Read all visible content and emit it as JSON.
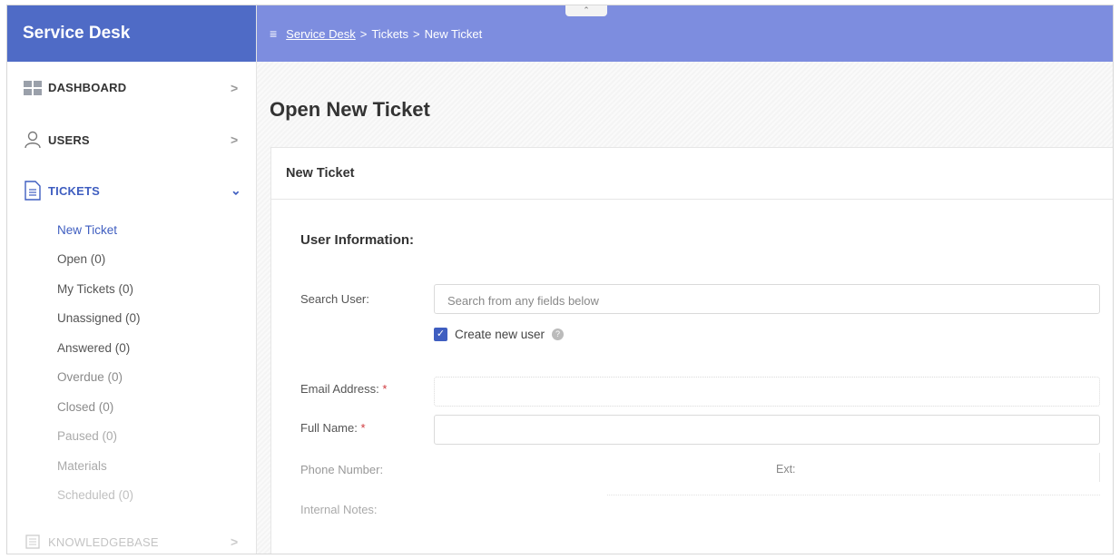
{
  "sidebar": {
    "brand": "Service Desk",
    "items": [
      {
        "label": "DASHBOARD",
        "icon": "dashboard-icon",
        "chevron": ">"
      },
      {
        "label": "USERS",
        "icon": "user-icon",
        "chevron": ">"
      },
      {
        "label": "TICKETS",
        "icon": "ticket-icon",
        "chevron": "⌄"
      },
      {
        "label": "KNOWLEDGEBASE",
        "icon": "knowledgebase-icon",
        "chevron": ">"
      }
    ],
    "ticket_sub_items": [
      "New Ticket",
      "Open (0)",
      "My Tickets (0)",
      "Unassigned (0)",
      "Answered (0)",
      "Overdue (0)",
      "Closed (0)",
      "Paused (0)",
      "Materials",
      "Scheduled (0)"
    ]
  },
  "topbar": {
    "menu_icon": "≡",
    "breadcrumb": [
      "Service Desk",
      "Tickets",
      "New Ticket"
    ],
    "separator": ">",
    "collapse_label": "⌃"
  },
  "main": {
    "page_title": "Open New Ticket",
    "card_title": "New Ticket",
    "section_title": "User Information:",
    "search_label": "Search User:",
    "search_placeholder": "Search from any fields below",
    "create_user_label": "Create new user",
    "email_label": "Email Address:",
    "full_name_label": "Full Name:",
    "phone_label": "Phone Number:",
    "ext_label": "Ext:",
    "notes_label": "Internal Notes:",
    "required_mark": "*"
  },
  "colors": {
    "brand": "#4f6bc6",
    "topbar": "#7d8ddf",
    "accent": "#3f5ec0",
    "required": "#d0393d"
  }
}
